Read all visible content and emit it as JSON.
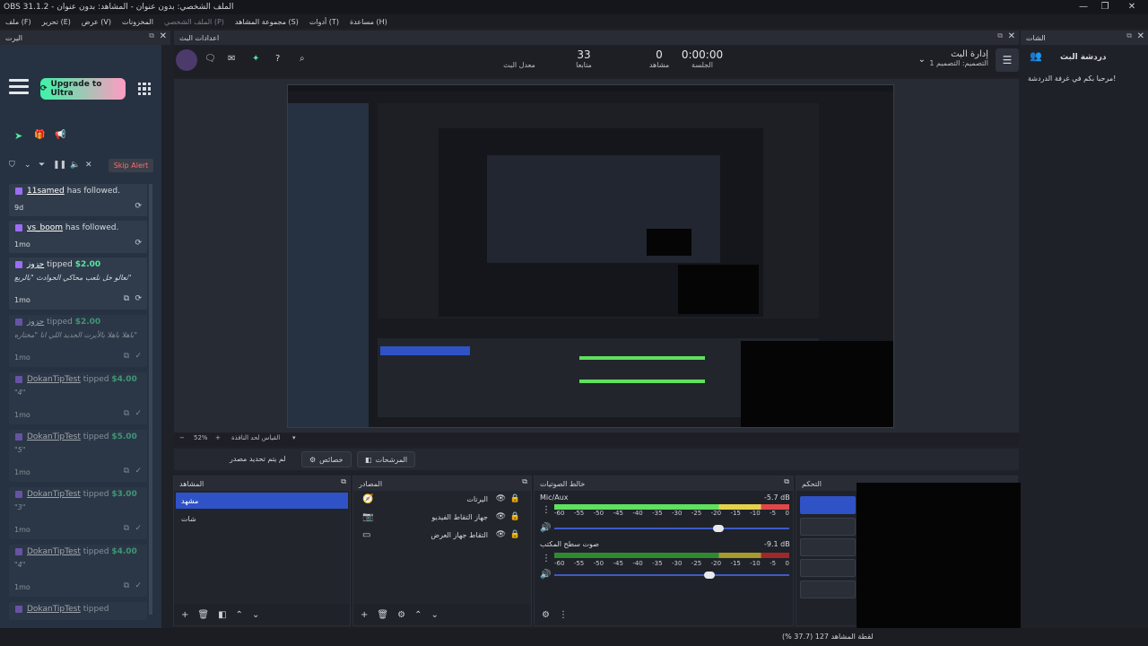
{
  "window": {
    "title": "OBS 31.1.2 - الملف الشخصي: بدون عنوان - المشاهد: بدون عنوان",
    "controls": [
      "—",
      "❐",
      "✕"
    ]
  },
  "menu": [
    "ملف (F)",
    "تحرير (E)",
    "عرض (V)",
    "المخزونات",
    "الملف الشخصي (P)",
    "مجموعة المشاهد (S)",
    "أدوات (T)",
    "مساعدة (H)"
  ],
  "alerts": {
    "header": "اليرت",
    "upgrade_label": "Upgrade to Ultra",
    "skip_label": "Skip Alert",
    "items": [
      {
        "name": "11samed",
        "text": "has followed.",
        "amount": "",
        "message": "",
        "time": "9d",
        "faded": false
      },
      {
        "name": "vs_boom",
        "text": "has followed.",
        "amount": "",
        "message": "",
        "time": "1mo",
        "faded": false
      },
      {
        "name": "حزوز",
        "text": "tipped",
        "amount": "$2.00",
        "message": "تعالو خل نلعب محاكي الحوادث \"بالربع\"",
        "time": "1mo",
        "faded": false
      },
      {
        "name": "حزوز",
        "text": "tipped",
        "amount": "$2.00",
        "message": "باهلا باهلا بالأيرت الجديد اللي انا \"مختاره\"",
        "time": "1mo",
        "faded": true
      },
      {
        "name": "DokanTipTest",
        "text": "tipped",
        "amount": "$4.00",
        "message": "\"4\"",
        "time": "1mo",
        "faded": true
      },
      {
        "name": "DokanTipTest",
        "text": "tipped",
        "amount": "$5.00",
        "message": "\"5\"",
        "time": "1mo",
        "faded": true
      },
      {
        "name": "DokanTipTest",
        "text": "tipped",
        "amount": "$3.00",
        "message": "\"3\"",
        "time": "1mo",
        "faded": true
      },
      {
        "name": "DokanTipTest",
        "text": "tipped",
        "amount": "$4.00",
        "message": "\"4\"",
        "time": "1mo",
        "faded": true
      },
      {
        "name": "DokanTipTest",
        "text": "tipped",
        "amount": "",
        "message": "",
        "time": "",
        "faded": true
      }
    ]
  },
  "stream": {
    "header": "اعدادات البث",
    "manager_title": "إدارة البث",
    "manager_sub": "التصميم: التصميم 1",
    "session_value": "0:00:00",
    "session_label": "الجلسة",
    "viewers_value": "0",
    "viewers_label": "مشاهد",
    "followers_value": "33",
    "followers_label": "متابعا",
    "rate_label": "معدل البث"
  },
  "preview": {
    "zoom": "52%",
    "fit_label": "القياس لحد النافذة",
    "no_source": "لم يتم تحديد مصدر",
    "props_label": "خصائص",
    "filters_label": "المرشحات"
  },
  "scenes": {
    "header": "المشاهد",
    "items": [
      {
        "label": "مشهد",
        "selected": true
      },
      {
        "label": "شات",
        "selected": false
      }
    ]
  },
  "sources": {
    "header": "المصادر",
    "items": [
      {
        "label": "اليرتات",
        "icon": "🧭"
      },
      {
        "label": "جهاز التقاط الفيديو",
        "icon": "📷"
      },
      {
        "label": "التقاط جهاز العرض",
        "icon": "▭"
      }
    ]
  },
  "mixer": {
    "header": "خالط الصوتيات",
    "channels": [
      {
        "name": "Mic/Aux",
        "db": "-5.7 dB",
        "level": 0.7
      },
      {
        "name": "صوت سطح المكتب",
        "db": "-9.1 dB",
        "level": 0.66
      }
    ],
    "scale": [
      "-60",
      "-55",
      "-50",
      "-45",
      "-40",
      "-35",
      "-30",
      "-25",
      "-20",
      "-15",
      "-10",
      "-5",
      "0"
    ]
  },
  "controls": {
    "header": "التحكم"
  },
  "chat": {
    "header": "الشات",
    "title": "دردشة البث",
    "welcome": "مرحبا بكم في غرفة الدردشة!"
  },
  "status": {
    "text": "لقطة المشاهد 127 (37.7 %)"
  },
  "colors": {
    "accent": "#2f52c7",
    "alert_bg": "#263241",
    "amount": "#54e6a0"
  }
}
